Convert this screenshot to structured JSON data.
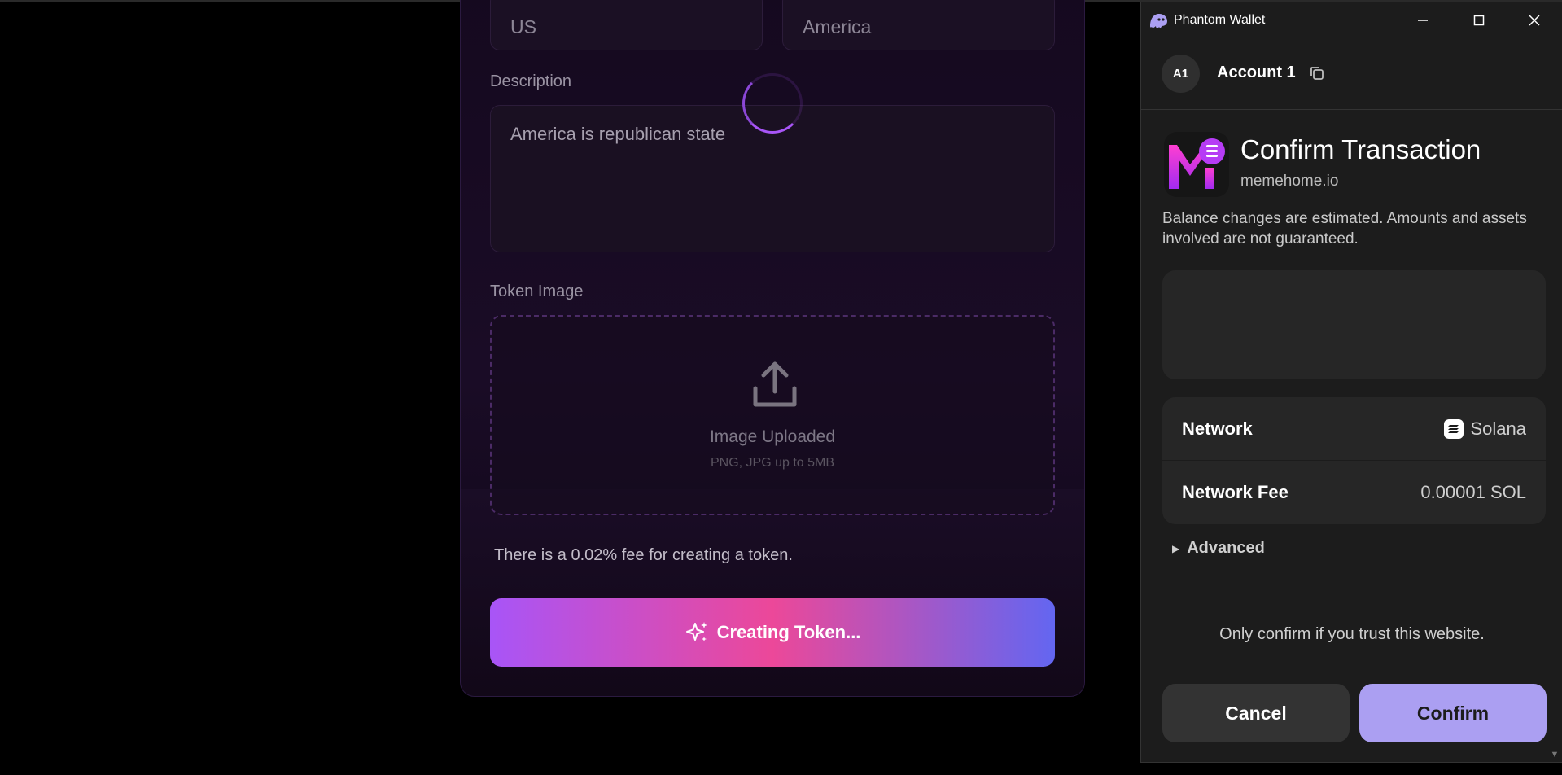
{
  "form": {
    "symbol_value": "US",
    "name_value": "America",
    "description_label": "Description",
    "description_value": "America is republican state",
    "token_image_label": "Token Image",
    "upload_title": "Image Uploaded",
    "upload_hint": "PNG, JPG up to 5MB",
    "fee_note": "There is a 0.02% fee for creating a token.",
    "create_button_label": "Creating Token..."
  },
  "wallet": {
    "window_title": "Phantom Wallet",
    "account_badge": "A1",
    "account_name": "Account 1",
    "heading": "Confirm Transaction",
    "domain": "memehome.io",
    "warning": "Balance changes are estimated. Amounts and assets involved are not guaranteed.",
    "network_label": "Network",
    "network_value": "Solana",
    "fee_label": "Network Fee",
    "fee_value": "0.00001 SOL",
    "advanced_label": "Advanced",
    "trust_note": "Only confirm if you trust this website.",
    "cancel_label": "Cancel",
    "confirm_label": "Confirm"
  },
  "colors": {
    "brand_gradient_start": "#a855f7",
    "brand_gradient_mid": "#ec4899",
    "brand_gradient_end": "#6366f1",
    "phantom_accent": "#ab9ff2"
  },
  "icons": {
    "window_controls": [
      "minimize-icon",
      "maximize-icon",
      "close-icon"
    ],
    "upload": "upload-icon",
    "sparkle": "sparkle-icon",
    "copy": "copy-icon",
    "solana": "solana-icon"
  }
}
